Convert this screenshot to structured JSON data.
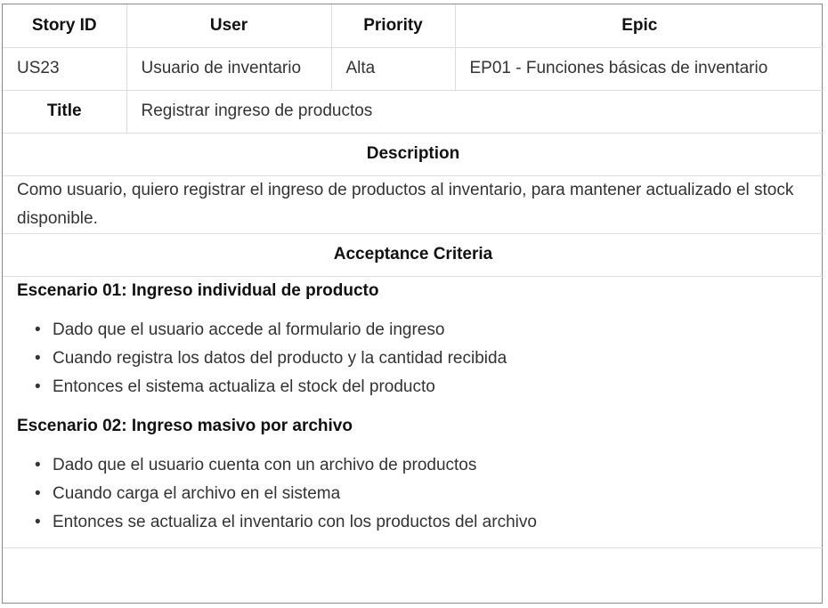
{
  "header": {
    "story_id_label": "Story ID",
    "user_label": "User",
    "priority_label": "Priority",
    "epic_label": "Epic"
  },
  "story": {
    "id": "US23",
    "user": "Usuario de inventario",
    "priority": "Alta",
    "epic": "EP01 - Funciones básicas de inventario",
    "title_label": "Title",
    "title": "Registrar ingreso de productos",
    "description_label": "Description",
    "description": "Como usuario, quiero registrar el ingreso de productos al inventario, para mantener actualizado el stock disponible.",
    "acceptance_label": "Acceptance Criteria"
  },
  "scenarios": [
    {
      "title": "Escenario 01: Ingreso individual de producto",
      "steps": [
        "Dado que el usuario accede al formulario de ingreso",
        "Cuando registra los datos del producto y la cantidad recibida",
        "Entonces el sistema actualiza el stock del producto"
      ]
    },
    {
      "title": "Escenario 02: Ingreso masivo por archivo",
      "steps": [
        "Dado que el usuario cuenta con un archivo de productos",
        "Cuando carga el archivo en el sistema",
        "Entonces se actualiza el inventario con los productos del archivo"
      ]
    }
  ]
}
